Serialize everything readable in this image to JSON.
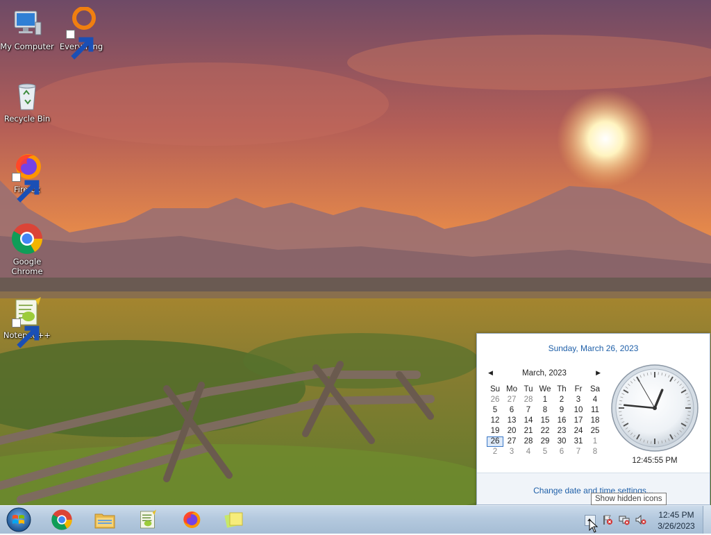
{
  "desktop": {
    "icons": [
      {
        "label": "My Computer",
        "icon": "computer-icon"
      },
      {
        "label": "Everything",
        "icon": "everything-search-icon"
      },
      {
        "label": "Recycle Bin",
        "icon": "recycle-bin-icon"
      },
      {
        "label": "Firefox",
        "icon": "firefox-icon"
      },
      {
        "label": "Google Chrome",
        "icon": "chrome-icon"
      },
      {
        "label": "Notepad++",
        "icon": "notepadpp-icon"
      }
    ]
  },
  "calendar": {
    "long_date": "Sunday, March 26, 2023",
    "month_label": "March, 2023",
    "prev_label": "◀",
    "next_label": "▶",
    "weekdays": [
      "Su",
      "Mo",
      "Tu",
      "We",
      "Th",
      "Fr",
      "Sa"
    ],
    "weeks": [
      [
        "26",
        "27",
        "28",
        "1",
        "2",
        "3",
        "4"
      ],
      [
        "5",
        "6",
        "7",
        "8",
        "9",
        "10",
        "11"
      ],
      [
        "12",
        "13",
        "14",
        "15",
        "16",
        "17",
        "18"
      ],
      [
        "19",
        "20",
        "21",
        "22",
        "23",
        "24",
        "25"
      ],
      [
        "26",
        "27",
        "28",
        "29",
        "30",
        "31",
        "1"
      ],
      [
        "2",
        "3",
        "4",
        "5",
        "6",
        "7",
        "8"
      ]
    ],
    "today": "26",
    "clock_time": "12:45:55 PM",
    "clock_hands": {
      "hour": 12,
      "minute": 45,
      "second": 55
    },
    "settings_link": "Change date and time settings..."
  },
  "tooltip": {
    "text": "Show hidden icons"
  },
  "taskbar": {
    "start_icon": "windows-start-orb-icon",
    "pinned_apps": [
      {
        "name": "Google Chrome",
        "icon": "chrome-icon"
      },
      {
        "name": "Windows Explorer",
        "icon": "folder-icon"
      },
      {
        "name": "Notepad++",
        "icon": "notepadpp-icon"
      },
      {
        "name": "Firefox",
        "icon": "firefox-icon"
      },
      {
        "name": "Sticky Notes",
        "icon": "sticky-notes-icon"
      }
    ],
    "tray_icons": [
      "show-hidden-icons-arrow-icon",
      "action-center-flag-icon",
      "network-disconnected-icon",
      "volume-muted-icon"
    ],
    "clock_time": "12:45 PM",
    "clock_date": "3/26/2023"
  },
  "colors": {
    "accent_link": "#1e5fa8",
    "taskbar": "#b4c9de",
    "today_highlight": "#3b78c7"
  }
}
